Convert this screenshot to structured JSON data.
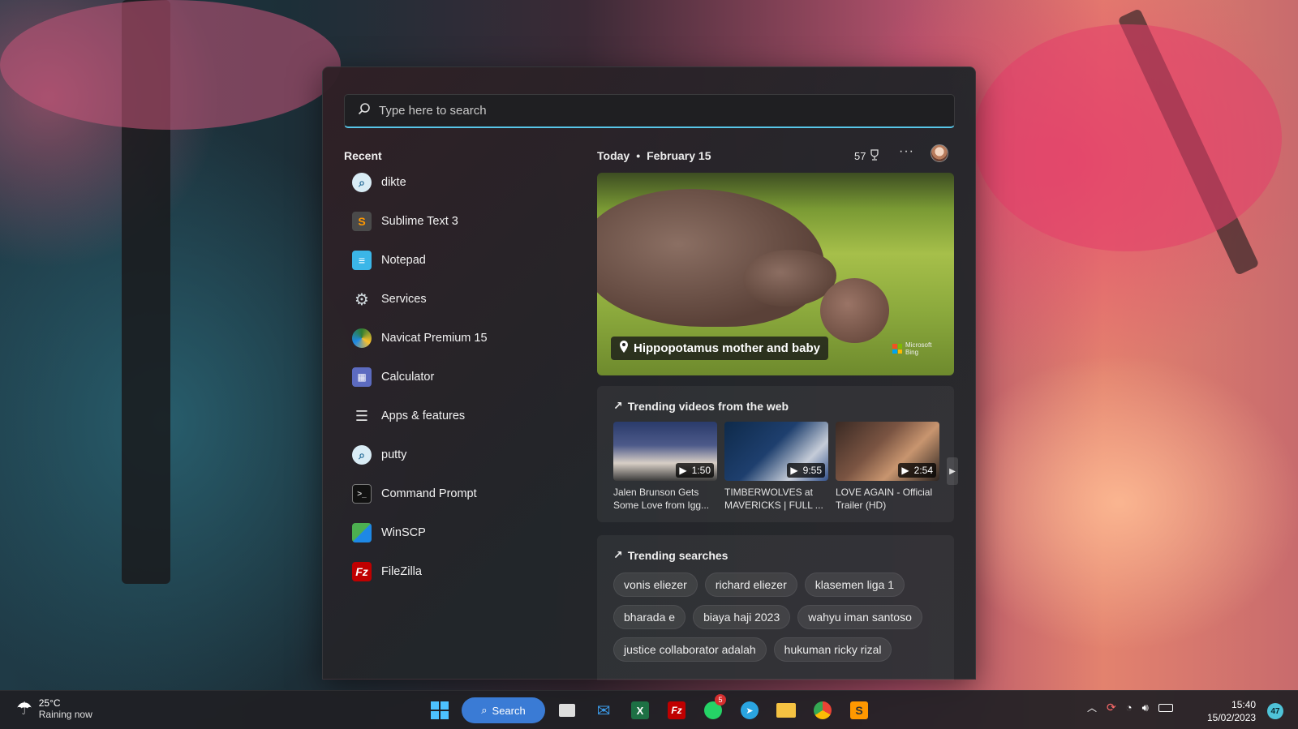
{
  "search": {
    "placeholder": "Type here to search"
  },
  "recent": {
    "title": "Recent",
    "items": [
      {
        "label": "dikte",
        "icon": "search-icon"
      },
      {
        "label": "Sublime Text 3",
        "icon": "sublime-text-icon"
      },
      {
        "label": "Notepad",
        "icon": "notepad-icon"
      },
      {
        "label": "Services",
        "icon": "services-gear-icon"
      },
      {
        "label": "Navicat Premium 15",
        "icon": "navicat-icon"
      },
      {
        "label": "Calculator",
        "icon": "calculator-icon"
      },
      {
        "label": "Apps & features",
        "icon": "apps-features-icon"
      },
      {
        "label": "putty",
        "icon": "search-icon"
      },
      {
        "label": "Command Prompt",
        "icon": "command-prompt-icon"
      },
      {
        "label": "WinSCP",
        "icon": "winscp-icon"
      },
      {
        "label": "FileZilla",
        "icon": "filezilla-icon"
      }
    ]
  },
  "today": {
    "label": "Today",
    "date": "February 15",
    "points": "57",
    "more": "···"
  },
  "hero": {
    "caption": "Hippopotamus mother and baby",
    "brand": "Microsoft Bing"
  },
  "trending_videos": {
    "title": "Trending videos from the web",
    "videos": [
      {
        "title": "Jalen Brunson Gets Some Love from Igg...",
        "duration": "1:50"
      },
      {
        "title": "TIMBERWOLVES at MAVERICKS | FULL ...",
        "duration": "9:55"
      },
      {
        "title": "LOVE AGAIN - Official Trailer (HD)",
        "duration": "2:54"
      }
    ]
  },
  "trending_searches": {
    "title": "Trending searches",
    "chips": [
      "vonis eliezer",
      "richard eliezer",
      "klasemen liga 1",
      "bharada e",
      "biaya haji 2023",
      "wahyu iman santoso",
      "justice collaborator adalah",
      "hukuman ricky rizal"
    ]
  },
  "taskbar": {
    "weather_temp": "25°C",
    "weather_cond": "Raining now",
    "search_label": "Search",
    "whatsapp_badge": "5",
    "time": "15:40",
    "date": "15/02/2023",
    "notifications": "47"
  },
  "colors": {
    "accent": "#58c6e8",
    "search_button": "#3a7bd5"
  }
}
